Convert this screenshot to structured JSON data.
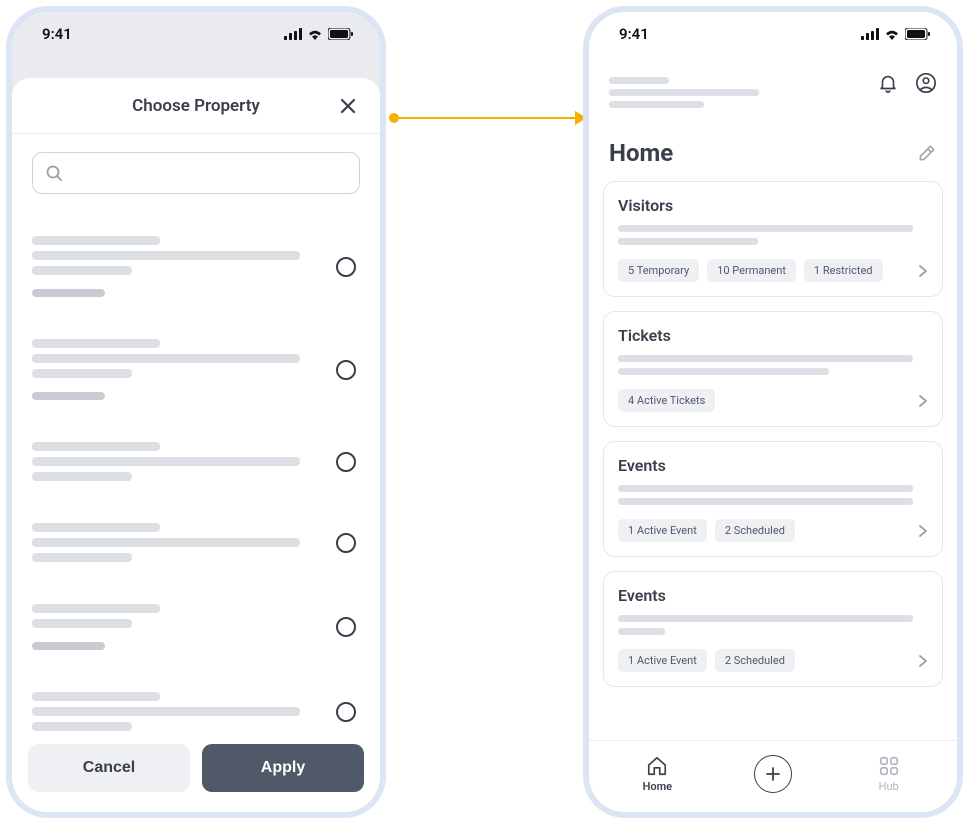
{
  "status_time": "9:41",
  "modal": {
    "title": "Choose Property",
    "search_placeholder": "",
    "cancel": "Cancel",
    "apply": "Apply"
  },
  "home": {
    "title": "Home"
  },
  "cards": [
    {
      "title": "Visitors",
      "chips": [
        "5 Temporary",
        "10 Permanent",
        "1 Restricted"
      ],
      "desc_lines": [
        "c1",
        "c2"
      ]
    },
    {
      "title": "Tickets",
      "chips": [
        "4 Active Tickets"
      ],
      "desc_lines": [
        "c1",
        "c3"
      ]
    },
    {
      "title": "Events",
      "chips": [
        "1 Active Event",
        "2 Scheduled"
      ],
      "desc_lines": [
        "c1",
        "c1"
      ]
    },
    {
      "title": "Events",
      "chips": [
        "1 Active Event",
        "2 Scheduled"
      ],
      "desc_lines": [
        "c1",
        "c4"
      ]
    }
  ],
  "nav": {
    "home": "Home",
    "hub": "Hub"
  }
}
